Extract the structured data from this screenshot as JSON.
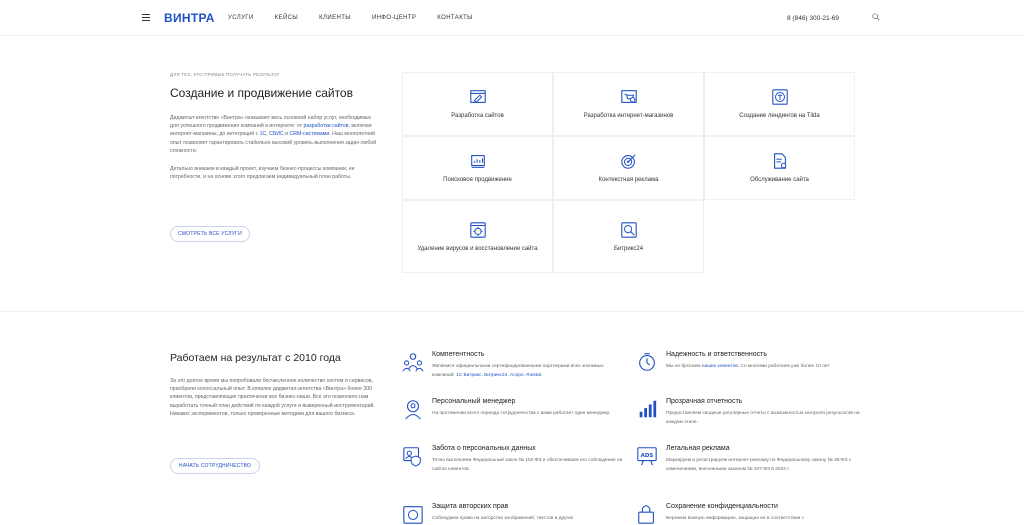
{
  "header": {
    "logo": "ВИНТРА",
    "nav": [
      "УСЛУГИ",
      "КЕЙСЫ",
      "КЛИЕНТЫ",
      "ИНФО-ЦЕНТР",
      "КОНТАКТЫ"
    ],
    "phone": "8 (846) 300-21-69"
  },
  "hero": {
    "eyebrow": "ДЛЯ ТЕХ, КТО ПРИВЫК ПОЛУЧАТЬ РЕЗУЛЬТАТ",
    "title": "Создание и продвижение сайтов",
    "p1_a": "Диджитал-агентство «Винтра» оказывает весь основной набор услуг, необходимых для успешного продвижения компаний в интернете: от ",
    "p1_link1": "разработки сайтов",
    "p1_b": ", включая интернет-магазины, до интеграций с ",
    "p1_link2": "1С",
    "p1_c": ", ",
    "p1_link3": "СБИС",
    "p1_d": " и ",
    "p1_link4": "CRM-системами",
    "p1_e": ". Наш многолетний опыт позволяет гарантировать стабильно высокий уровень выполнения задач любой сложности.",
    "p2": "Детально вникаем в каждый проект, изучаем бизнес-процессы компании, ее потребности, и на основе этого предлагаем индивидуальный план работы.",
    "button": "СМОТРЕТЬ ВСЕ УСЛУГИ"
  },
  "services": [
    {
      "label": "Разработка сайтов",
      "icon": "website-edit-icon"
    },
    {
      "label": "Разработка интернет-магазинов",
      "icon": "shop-icon"
    },
    {
      "label": "Создание лендингов на Tilda",
      "icon": "tilda-icon"
    },
    {
      "label": "Поисковое продвижение",
      "icon": "seo-chart-icon"
    },
    {
      "label": "Контекстная реклама",
      "icon": "target-icon"
    },
    {
      "label": "Обслуживание сайта",
      "icon": "document-gear-icon"
    },
    {
      "label": "Удаление вирусов и восстановление сайта",
      "icon": "virus-icon"
    },
    {
      "label": "Битрикс24",
      "icon": "bitrix-icon"
    }
  ],
  "results": {
    "title": "Работаем на результат с 2010 года",
    "text": "За это долгое время мы попробовали бесчисленное количество систем и сервисов, приобрели колоссальный опыт. В копилке диджитал-агентства «Винтра» более 300 клиентов, представляющие практически все бизнес-ниши. Все это позволило нам выработать точный план действий по каждой услуге и выверенный инструментарий. Никаких экспериментов, только проверенные методики для вашего бизнеса.",
    "button": "НАЧАТЬ СОТРУДНИЧЕСТВО"
  },
  "features": [
    {
      "title": "Компетентность",
      "text": "Являемся официальными сертифицированными партнерами всех значимых компаний: ",
      "link": "1С Битрикс, Битрикс24, Аспро, Roistat",
      "icon": "team-icon"
    },
    {
      "title": "Надежность и ответственность",
      "text": "Мы не бросаем ",
      "link": "наших клиентов",
      "text2": ". Со многими работаем уже более 10 лет",
      "icon": "clock-icon"
    },
    {
      "title": "Персональный менеджер",
      "text": "На протяжении всего периода сотрудничества с вами работает один менеджер.",
      "icon": "manager-icon"
    },
    {
      "title": "Прозрачная отчетность",
      "text": "Предоставляем сводные регулярные отчеты с возможностью контроля результатов на каждом этапе.",
      "icon": "bar-chart-icon"
    },
    {
      "title": "Забота о персональных данных",
      "text": "Точно выполняем Федеральный закон № 152-ФЗ и обеспечиваем его соблюдение на сайтах клиентов.",
      "icon": "data-protection-icon"
    },
    {
      "title": "Легальная реклама",
      "text": "Маркируем и регистрируем интернет-рекламу по Федеральному закону № 38-ФЗ с изменениями, внесенными законом № 347-ФЗ в 2022 г.",
      "icon": "ads-icon"
    },
    {
      "title": "Защита авторских прав",
      "text": "Соблюдаем права на авторство изображений, текстов и других",
      "icon": "copyright-icon"
    },
    {
      "title": "Сохранение конфиденциальности",
      "text": "Бережем важную информацию, защищая ее в соответствии с",
      "icon": "lock-icon"
    }
  ]
}
